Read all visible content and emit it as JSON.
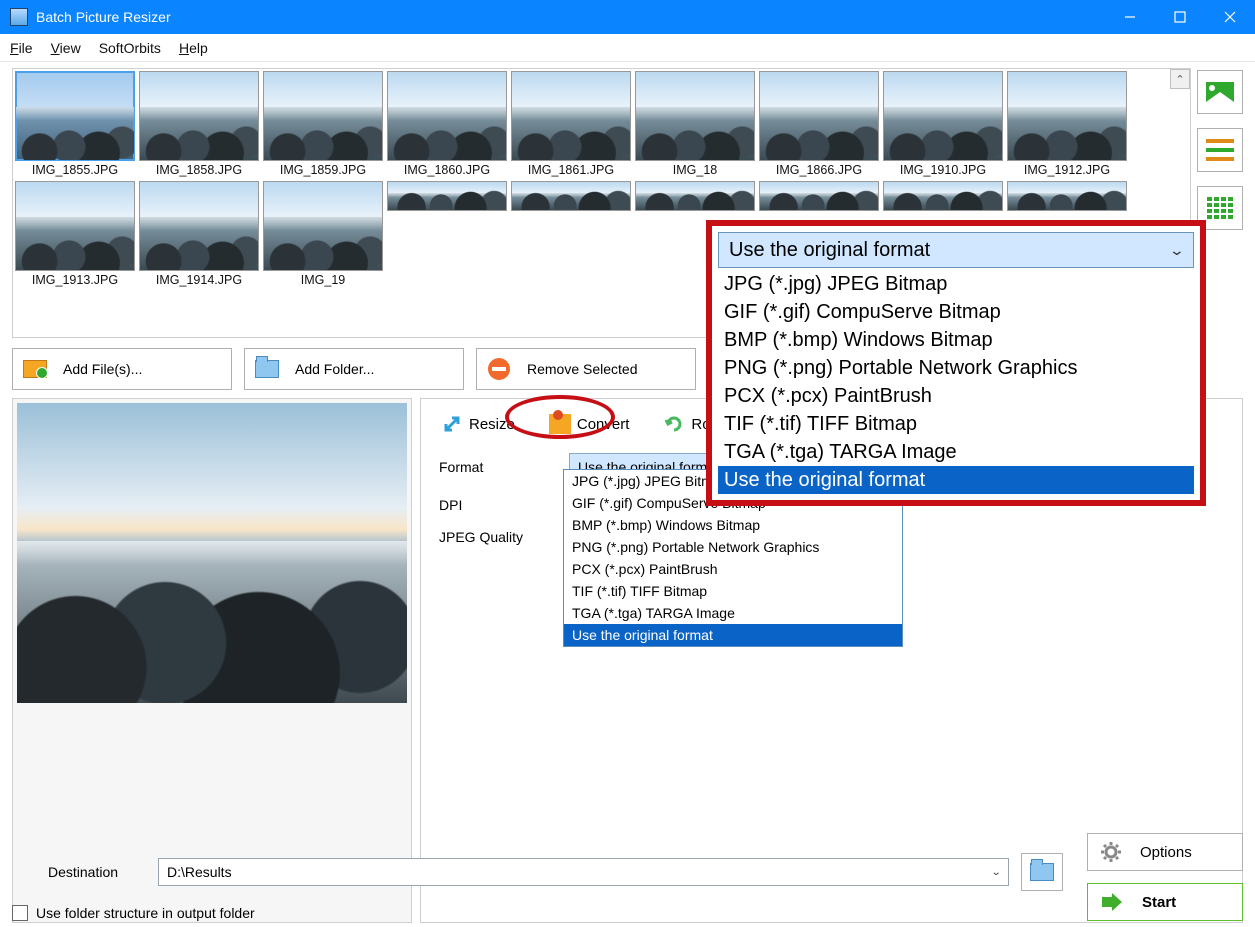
{
  "window": {
    "title": "Batch Picture Resizer"
  },
  "menu": {
    "file": "File",
    "view": "View",
    "softorbits": "SoftOrbits",
    "help": "Help"
  },
  "thumbs": [
    {
      "name": "IMG_1855.JPG",
      "selected": true
    },
    {
      "name": "IMG_1858.JPG"
    },
    {
      "name": "IMG_1859.JPG"
    },
    {
      "name": "IMG_1860.JPG"
    },
    {
      "name": "IMG_1861.JPG"
    },
    {
      "name": "IMG_18"
    },
    {
      "name": "IMG_1866.JPG"
    },
    {
      "name": "IMG_1910.JPG"
    },
    {
      "name": "IMG_1912.JPG"
    },
    {
      "name": "IMG_1913.JPG"
    },
    {
      "name": "IMG_1914.JPG"
    },
    {
      "name": "IMG_19"
    }
  ],
  "actions": {
    "addfiles": "Add File(s)...",
    "addfolder": "Add Folder...",
    "remove": "Remove Selected"
  },
  "tabs": {
    "resize": "Resize",
    "convert": "Convert",
    "rotate": "Rotate"
  },
  "form": {
    "format_label": "Format",
    "dpi_label": "DPI",
    "jpeg_label": "JPEG Quality",
    "format_value": "Use the original format"
  },
  "format_options": [
    "JPG (*.jpg) JPEG Bitmap",
    "GIF (*.gif) CompuServe Bitmap",
    "BMP (*.bmp) Windows Bitmap",
    "PNG (*.png) Portable Network Graphics",
    "PCX (*.pcx) PaintBrush",
    "TIF (*.tif) TIFF Bitmap",
    "TGA (*.tga) TARGA Image",
    "Use the original format"
  ],
  "overlay": {
    "selected": "Use the original format"
  },
  "bottom": {
    "destination_label": "Destination",
    "destination_value": "D:\\Results",
    "usefolder": "Use folder structure in output folder",
    "options": "Options",
    "start": "Start"
  }
}
